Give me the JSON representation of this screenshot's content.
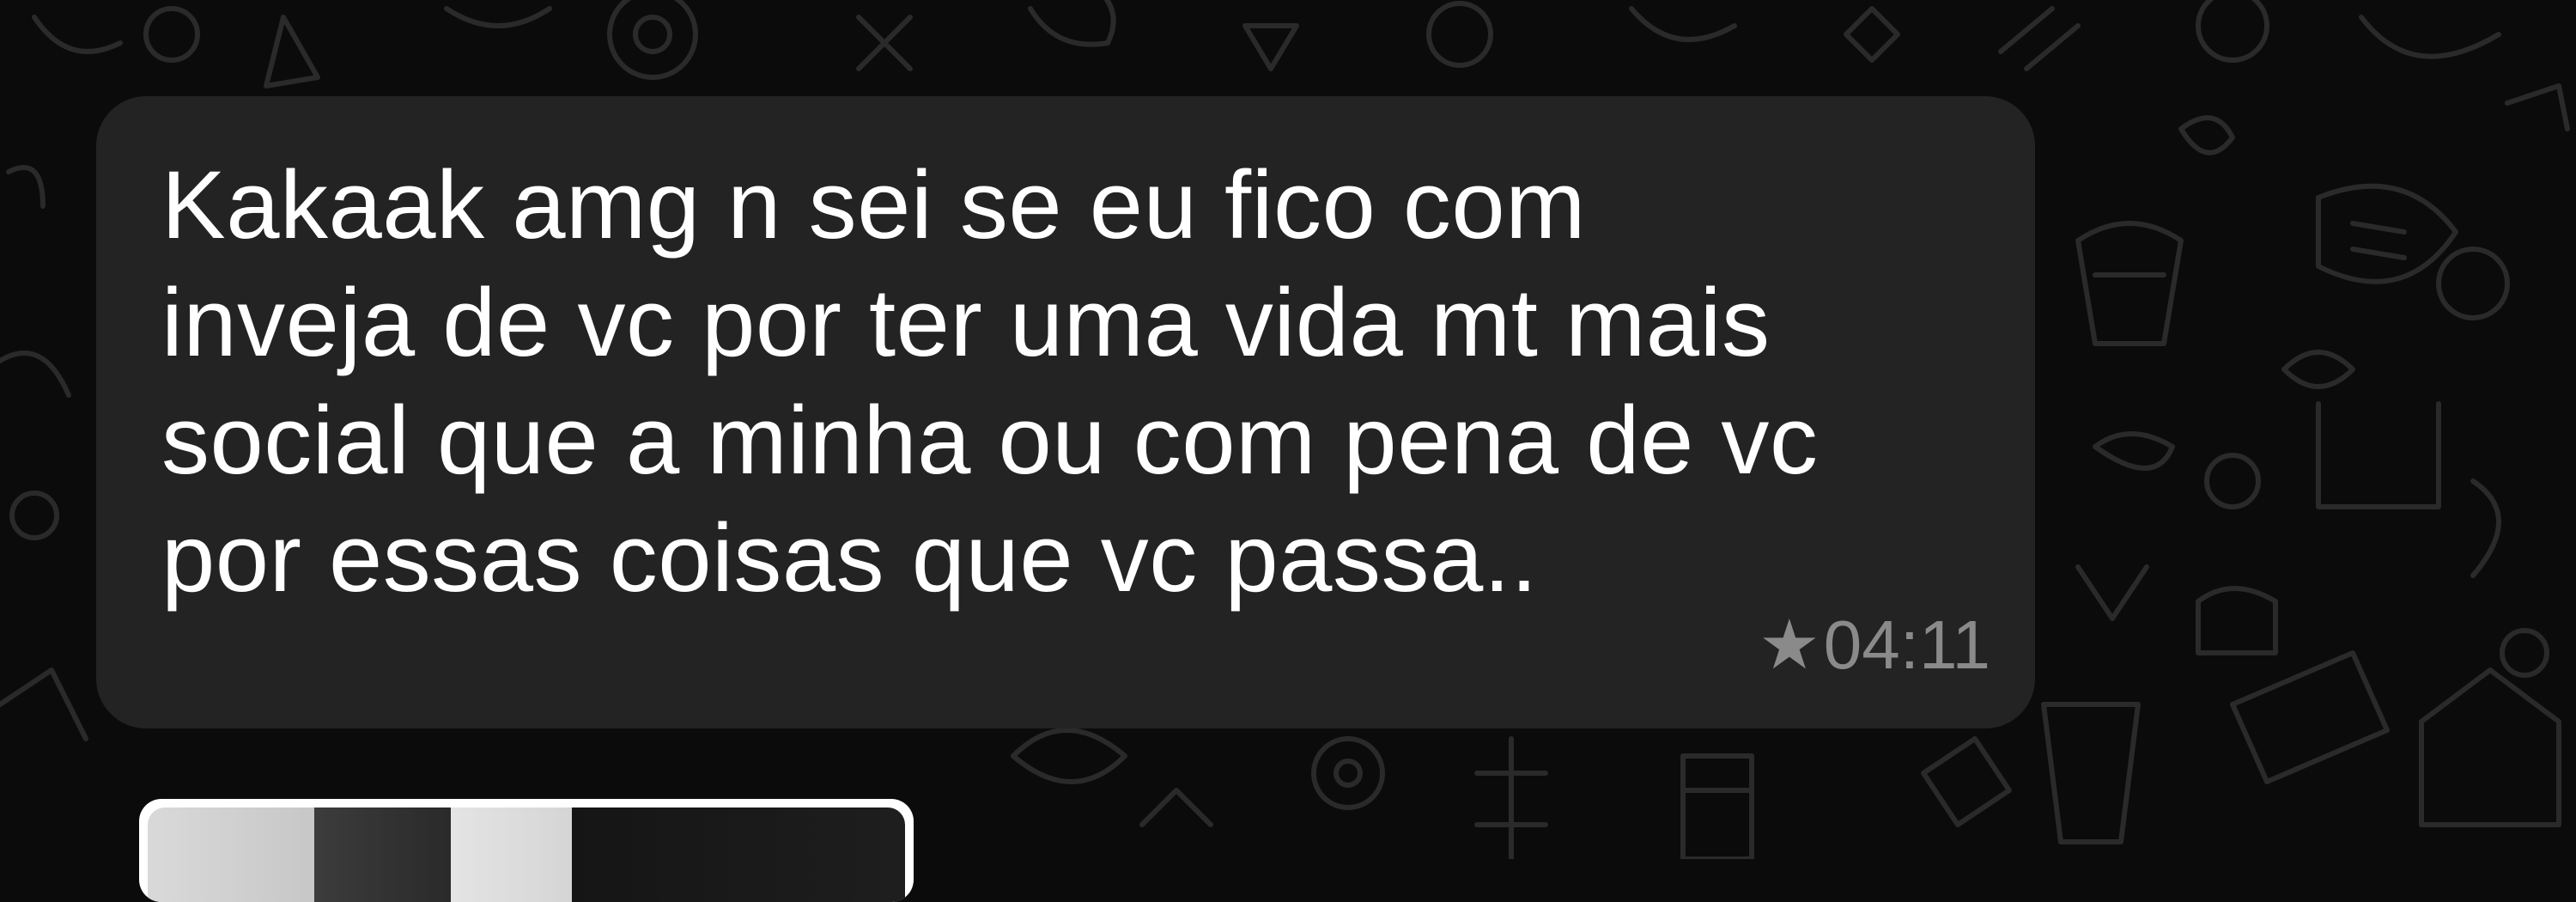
{
  "message": {
    "lines": [
      "Kakaak amg n sei se eu fico com",
      "inveja de vc por ter uma vida mt mais",
      "social que a minha ou com pena de vc",
      "por essas coisas que vc passa.."
    ],
    "starred_icon": "★",
    "time": "04:11"
  },
  "icons": {
    "star": "star-icon"
  }
}
